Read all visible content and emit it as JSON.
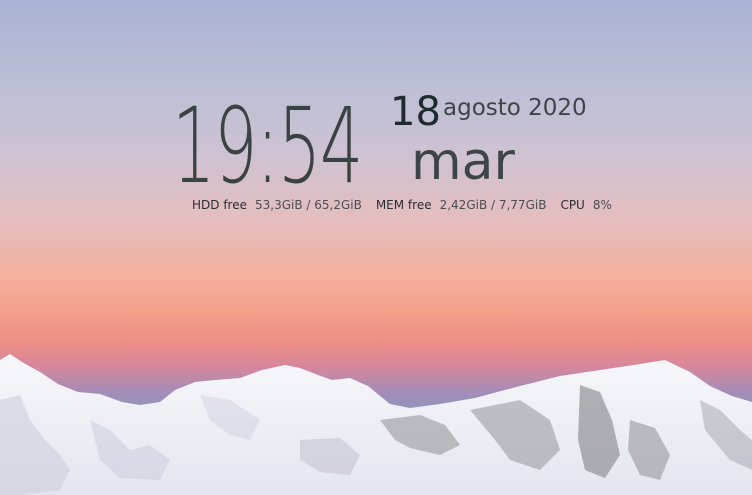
{
  "clock": {
    "time": "19:54"
  },
  "date": {
    "day": "18",
    "month_year": "agosto 2020",
    "weekday": "mar"
  },
  "stats": {
    "hdd_label": "HDD free",
    "hdd_value": "53,3GiB / 65,2GiB",
    "mem_label": "MEM free",
    "mem_value": "2,42GiB / 7,77GiB",
    "cpu_label": "CPU",
    "cpu_value": "8%"
  },
  "wallpaper": {
    "subject": "snow-mountains-sunset"
  }
}
